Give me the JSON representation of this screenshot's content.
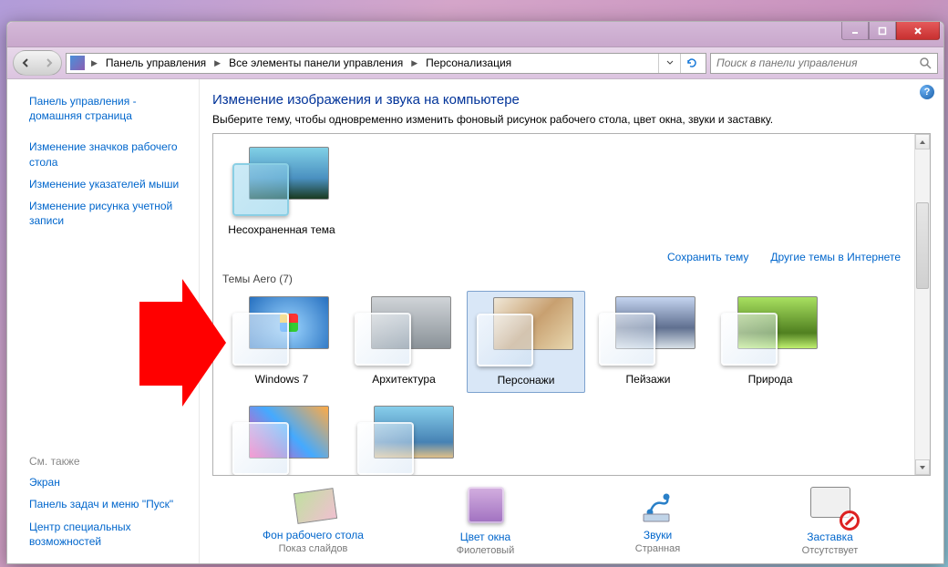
{
  "breadcrumbs": [
    "Панель управления",
    "Все элементы панели управления",
    "Персонализация"
  ],
  "search_placeholder": "Поиск в панели управления",
  "sidebar": {
    "top": [
      "Панель управления - домашняя страница",
      "Изменение значков рабочего стола",
      "Изменение указателей мыши",
      "Изменение рисунка учетной записи"
    ],
    "see_also_heading": "См. также",
    "see_also": [
      "Экран",
      "Панель задач и меню \"Пуск\"",
      "Центр специальных возможностей"
    ]
  },
  "main": {
    "title": "Изменение изображения и звука на компьютере",
    "subtitle": "Выберите тему, чтобы одновременно изменить фоновый рисунок рабочего стола, цвет окна, звуки и заставку.",
    "unsaved_theme_label": "Несохраненная тема",
    "save_theme": "Сохранить тему",
    "more_themes": "Другие темы в Интернете",
    "aero_section": "Темы Aero (7)",
    "themes": [
      {
        "label": "Windows 7",
        "bg": "bg-w7"
      },
      {
        "label": "Архитектура",
        "bg": "bg-arch"
      },
      {
        "label": "Персонажи",
        "bg": "bg-char",
        "selected": true
      },
      {
        "label": "Пейзажи",
        "bg": "bg-land"
      },
      {
        "label": "Природа",
        "bg": "bg-nat"
      }
    ]
  },
  "bottom": [
    {
      "title": "Фон рабочего стола",
      "sub": "Показ слайдов",
      "icon": "wallpaper"
    },
    {
      "title": "Цвет окна",
      "sub": "Фиолетовый",
      "icon": "color"
    },
    {
      "title": "Звуки",
      "sub": "Странная",
      "icon": "sound"
    },
    {
      "title": "Заставка",
      "sub": "Отсутствует",
      "icon": "saver"
    }
  ]
}
